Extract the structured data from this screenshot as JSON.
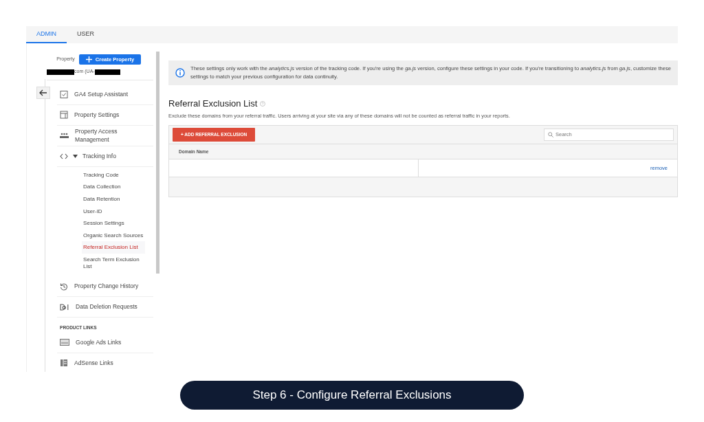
{
  "tabs": [
    {
      "label": "ADMIN",
      "selected": true
    },
    {
      "label": "USER",
      "selected": false
    }
  ],
  "sidebar": {
    "property_label": "Property",
    "create_button": "Create Property",
    "account": "com (UA-",
    "items": [
      {
        "label": "GA4 Setup Assistant",
        "kind": "item"
      },
      {
        "label": "Property Settings",
        "kind": "item"
      },
      {
        "label": "Property Access Management",
        "kind": "item"
      },
      {
        "label": "Tracking Info",
        "kind": "item",
        "expanded": true,
        "children": [
          {
            "label": "Tracking Code",
            "selected": false
          },
          {
            "label": "Data Collection",
            "selected": false
          },
          {
            "label": "Data Retention",
            "selected": false
          },
          {
            "label": "User-ID",
            "selected": false
          },
          {
            "label": "Session Settings",
            "selected": false
          },
          {
            "label": "Organic Search Sources",
            "selected": false
          },
          {
            "label": "Referral Exclusion List",
            "selected": true
          },
          {
            "label": "Search Term Exclusion List",
            "selected": false
          }
        ]
      },
      {
        "label": "Property Change History",
        "kind": "item"
      },
      {
        "label": "Data Deletion Requests",
        "kind": "item"
      },
      {
        "label": "PRODUCT LINKS",
        "kind": "section"
      },
      {
        "label": "Google Ads Links",
        "kind": "item"
      },
      {
        "label": "AdSense Links",
        "kind": "item"
      }
    ]
  },
  "info": "These settings only work with the *analytics.js* version of the tracking code. If you're using the *ga.js* version, configure these settings in your code. If you're transitioning to *analytics.js* from *ga.js*, customize these settings to match your previous configuration for data continuity.",
  "heading": "Referral Exclusion List",
  "description": "Exclude these domains from your referral traffic. Users arriving at your site via any of these domains will not be counted as referral traffic in your reports.",
  "add_button": "+ ADD REFERRAL EXCLUSION",
  "search": {
    "placeholder": "Search"
  },
  "table": {
    "columns": [
      "Domain Name"
    ],
    "rows": [
      {
        "action": "remove"
      }
    ]
  },
  "caption": "Step 6 - Configure Referral Exclusions"
}
